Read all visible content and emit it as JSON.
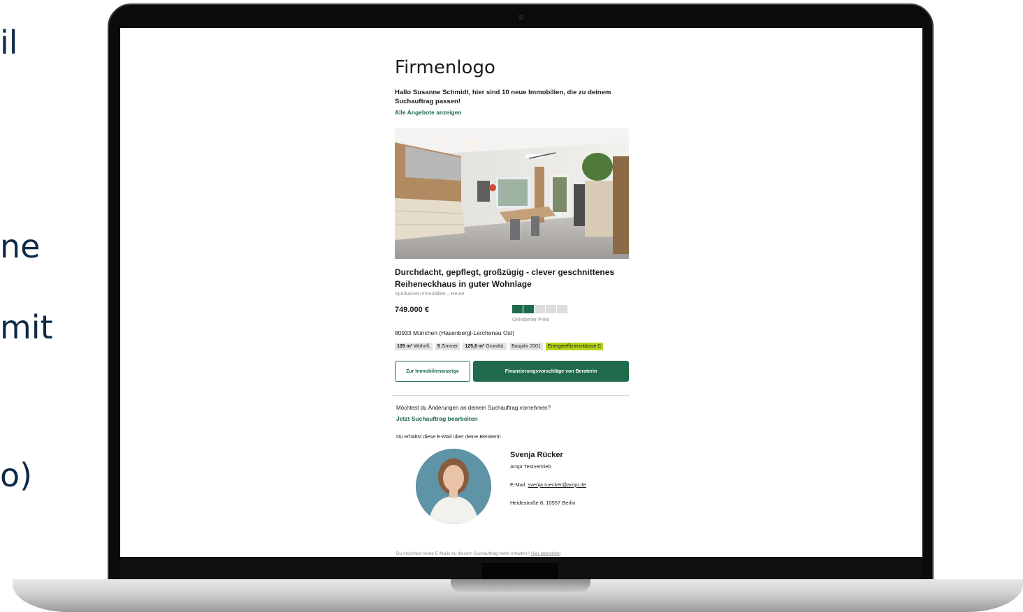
{
  "side_text": {
    "line1": "il",
    "line2": "ne",
    "line3": "mit",
    "line4": "o)"
  },
  "email": {
    "logo": "Firmenlogo",
    "greeting": "Hallo Susanne Schmidt, hier sind 10 neue Immobilien, die zu deinem Suchauftrag passen!",
    "all_offers_link": "Alle Angebote anzeigen",
    "listing": {
      "title": "Durchdacht, gepflegt, großzügig - clever geschnittenes Reiheneckhaus in guter Wohnlage",
      "source": "Sparkassen Immobilien – Heute",
      "price": "749.000 €",
      "price_level_filled": 2,
      "price_level_total": 5,
      "price_level_label": "Gehobener Preis",
      "address": "80933 München (Hasenbergl-Lerchenau Ost)",
      "tags": [
        {
          "bold": "105 m²",
          "text": " Wohnfl."
        },
        {
          "bold": "5",
          "text": " Zimmer"
        },
        {
          "bold": "125,6 m²",
          "text": " Grundst."
        },
        {
          "bold": "",
          "text": "Baujahr 2001"
        },
        {
          "bold": "",
          "text": "Energieeffizienzklasse C",
          "energy": true
        }
      ],
      "btn_listing": "Zur Immobilienanzeige",
      "btn_financing": "Finanzierungsvorschläge von Beraterin"
    },
    "change_question": "Möchtest du Änderungen an deinem Suchauftrag vornehmen?",
    "change_link": "Jetzt Suchauftrag bearbeiten",
    "receive_info": "Du erhältst diese E-Mail über deine Beraterin",
    "advisor": {
      "name": "Svenja Rücker",
      "company": "Ampr Testvertrieb",
      "email_prefix": "E-Mail: ",
      "email": "svenja.ruecker@ampr.de",
      "address": "Heidestraße 8, 10557 Berlin"
    },
    "unsubscribe_text": "Du möchtest keine E-Mails zu diesem Suchauftrag mehr erhalten? ",
    "unsubscribe_link": "Hier abmelden"
  },
  "colors": {
    "accent_green": "#1f6a4a",
    "energy_badge": "#b6d41a",
    "slide_text": "#0e2a47"
  }
}
